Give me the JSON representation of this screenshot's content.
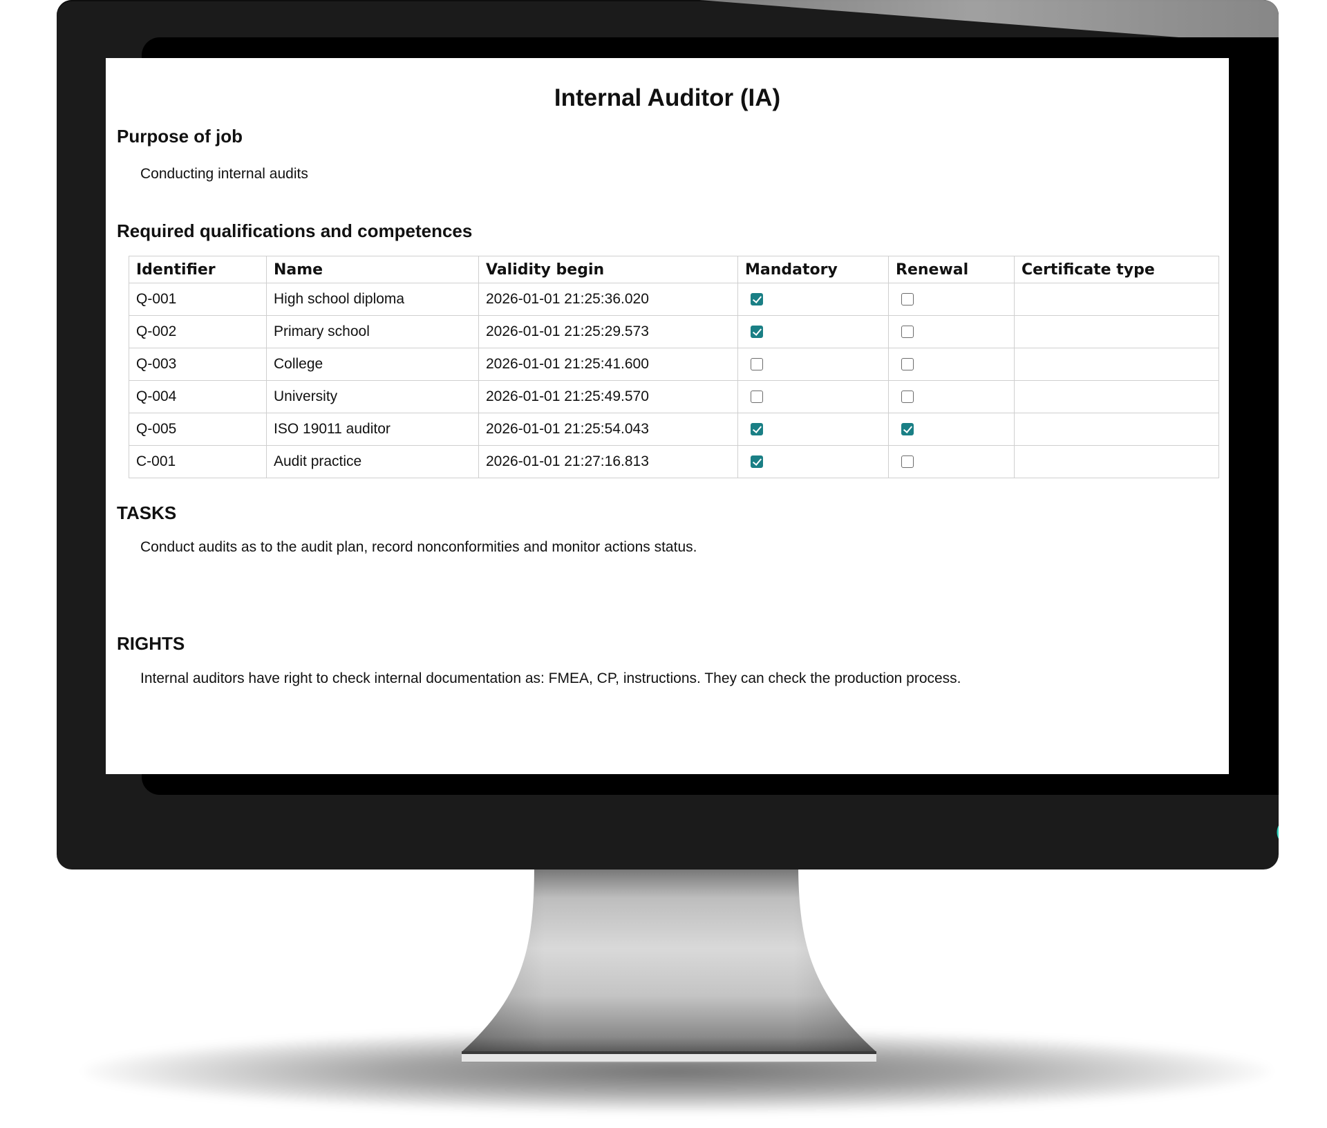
{
  "document": {
    "title": "Internal Auditor (IA)",
    "purpose_heading": "Purpose of job",
    "purpose_text": "Conducting internal audits",
    "qualifications_heading": "Required qualifications and competences",
    "tasks_heading": "TASKS",
    "tasks_text": "Conduct audits as to the audit plan, record nonconformities and monitor actions status.",
    "rights_heading": "RIGHTS",
    "rights_text": "Internal auditors have right to check internal documentation as: FMEA, CP, instructions. They can check the production process."
  },
  "table": {
    "headers": [
      "Identifier",
      "Name",
      "Validity begin",
      "Mandatory",
      "Renewal",
      "Certificate type"
    ],
    "rows": [
      {
        "identifier": "Q-001",
        "name": "High school diploma",
        "validity_begin": "2026-01-01 21:25:36.020",
        "mandatory": true,
        "renewal": false,
        "certificate_type": ""
      },
      {
        "identifier": "Q-002",
        "name": "Primary school",
        "validity_begin": "2026-01-01 21:25:29.573",
        "mandatory": true,
        "renewal": false,
        "certificate_type": ""
      },
      {
        "identifier": "Q-003",
        "name": "College",
        "validity_begin": "2026-01-01 21:25:41.600",
        "mandatory": false,
        "renewal": false,
        "certificate_type": ""
      },
      {
        "identifier": "Q-004",
        "name": "University",
        "validity_begin": "2026-01-01 21:25:49.570",
        "mandatory": false,
        "renewal": false,
        "certificate_type": ""
      },
      {
        "identifier": "Q-005",
        "name": "ISO 19011 auditor",
        "validity_begin": "2026-01-01 21:25:54.043",
        "mandatory": true,
        "renewal": true,
        "certificate_type": ""
      },
      {
        "identifier": "C-001",
        "name": "Audit practice",
        "validity_begin": "2026-01-01 21:27:16.813",
        "mandatory": true,
        "renewal": false,
        "certificate_type": ""
      }
    ]
  },
  "colors": {
    "checkbox_checked": "#1a7f85",
    "power_icon": "#2fd6c0",
    "bezel": "#1b1b1b"
  },
  "icons": {
    "power": "power-icon"
  }
}
